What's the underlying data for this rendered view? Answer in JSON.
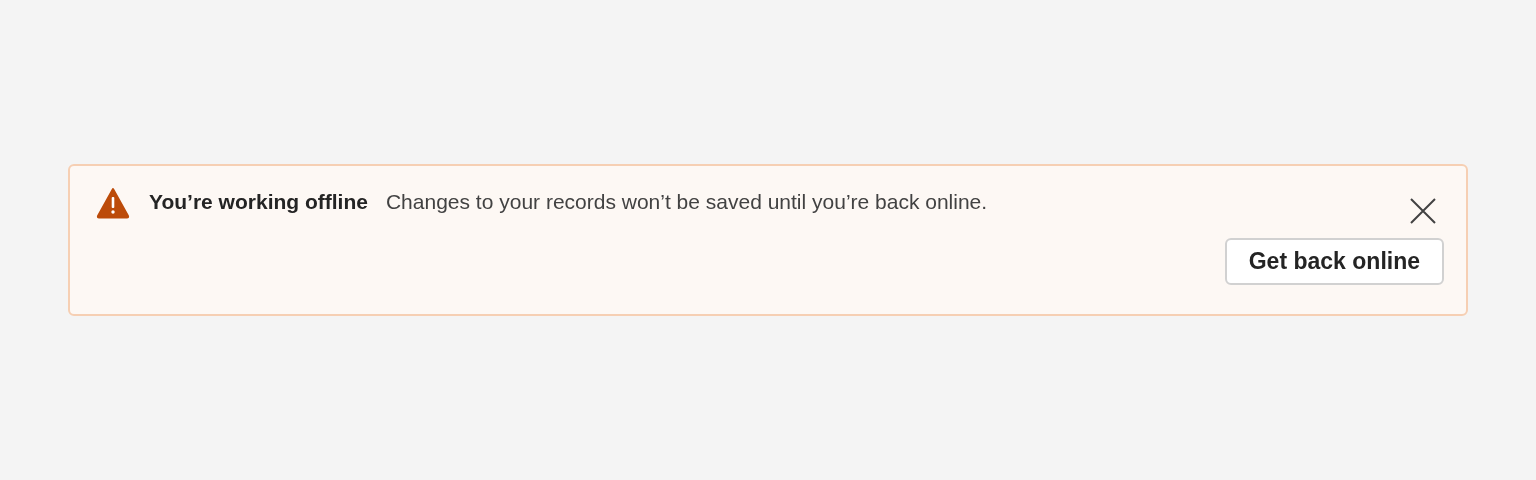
{
  "banner": {
    "title": "You’re working offline",
    "message": "Changes to your records won’t be saved until you’re back online.",
    "action": "Get back online"
  }
}
